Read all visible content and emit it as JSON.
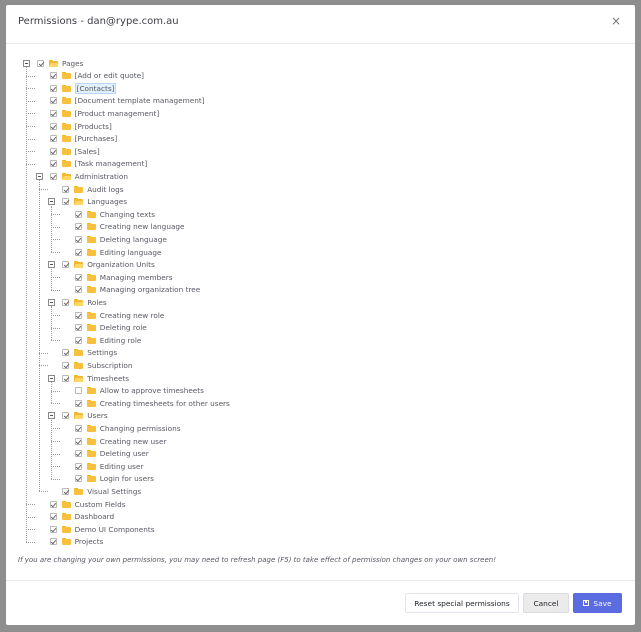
{
  "modal": {
    "title": "Permissions - dan@rype.com.au",
    "close_glyph": "×",
    "note": "If you are changing your own permissions, you may need to refresh page (F5) to take effect of permission changes on your own screen!"
  },
  "footer": {
    "reset_label": "Reset special permissions",
    "cancel_label": "Cancel",
    "save_label": "Save"
  },
  "tree": [
    {
      "id": "pages",
      "label": "Pages",
      "level": 0,
      "checked": true,
      "expanded": true,
      "icon": "folder-open-icon"
    },
    {
      "id": "add-edit-quote",
      "label": "[Add or edit quote]",
      "level": 1,
      "checked": true
    },
    {
      "id": "contacts",
      "label": "[Contacts]",
      "level": 1,
      "checked": true,
      "selected": true
    },
    {
      "id": "document-template-management",
      "label": "[Document template management]",
      "level": 1,
      "checked": true
    },
    {
      "id": "product-management",
      "label": "[Product management]",
      "level": 1,
      "checked": true
    },
    {
      "id": "products",
      "label": "[Products]",
      "level": 1,
      "checked": true
    },
    {
      "id": "purchases",
      "label": "[Purchases]",
      "level": 1,
      "checked": true
    },
    {
      "id": "sales",
      "label": "[Sales]",
      "level": 1,
      "checked": true
    },
    {
      "id": "task-management",
      "label": "[Task management]",
      "level": 1,
      "checked": true
    },
    {
      "id": "administration",
      "label": "Administration",
      "level": 1,
      "checked": true,
      "expanded": true,
      "icon": "folder-open-icon"
    },
    {
      "id": "audit-logs",
      "label": "Audit logs",
      "level": 2,
      "checked": true
    },
    {
      "id": "languages",
      "label": "Languages",
      "level": 2,
      "checked": true,
      "expanded": true,
      "icon": "folder-open-icon"
    },
    {
      "id": "changing-texts",
      "label": "Changing texts",
      "level": 3,
      "checked": true
    },
    {
      "id": "creating-new-language",
      "label": "Creating new language",
      "level": 3,
      "checked": true
    },
    {
      "id": "deleting-language",
      "label": "Deleting language",
      "level": 3,
      "checked": true
    },
    {
      "id": "editing-language",
      "label": "Editing language",
      "level": 3,
      "checked": true
    },
    {
      "id": "organization-units",
      "label": "Organization Units",
      "level": 2,
      "checked": true,
      "expanded": true,
      "icon": "folder-open-icon"
    },
    {
      "id": "managing-members",
      "label": "Managing members",
      "level": 3,
      "checked": true
    },
    {
      "id": "managing-organization-tree",
      "label": "Managing organization tree",
      "level": 3,
      "checked": true
    },
    {
      "id": "roles",
      "label": "Roles",
      "level": 2,
      "checked": true,
      "expanded": true,
      "icon": "folder-open-icon"
    },
    {
      "id": "creating-new-role",
      "label": "Creating new role",
      "level": 3,
      "checked": true
    },
    {
      "id": "deleting-role",
      "label": "Deleting role",
      "level": 3,
      "checked": true
    },
    {
      "id": "editing-role",
      "label": "Editing role",
      "level": 3,
      "checked": true
    },
    {
      "id": "settings",
      "label": "Settings",
      "level": 2,
      "checked": true
    },
    {
      "id": "subscription",
      "label": "Subscription",
      "level": 2,
      "checked": true
    },
    {
      "id": "timesheets",
      "label": "Timesheets",
      "level": 2,
      "checked": true,
      "expanded": true,
      "icon": "folder-open-icon"
    },
    {
      "id": "allow-approve-timesheets",
      "label": "Allow to approve timesheets",
      "level": 3,
      "checked": false
    },
    {
      "id": "creating-timesheets-other-users",
      "label": "Creating timesheets for other users",
      "level": 3,
      "checked": true
    },
    {
      "id": "users",
      "label": "Users",
      "level": 2,
      "checked": true,
      "expanded": true,
      "icon": "folder-open-icon"
    },
    {
      "id": "changing-permissions",
      "label": "Changing permissions",
      "level": 3,
      "checked": true
    },
    {
      "id": "creating-new-user",
      "label": "Creating new user",
      "level": 3,
      "checked": true
    },
    {
      "id": "deleting-user",
      "label": "Deleting user",
      "level": 3,
      "checked": true
    },
    {
      "id": "editing-user",
      "label": "Editing user",
      "level": 3,
      "checked": true
    },
    {
      "id": "login-for-users",
      "label": "Login for users",
      "level": 3,
      "checked": true
    },
    {
      "id": "visual-settings",
      "label": "Visual Settings",
      "level": 2,
      "checked": true
    },
    {
      "id": "custom-fields",
      "label": "Custom Fields",
      "level": 1,
      "checked": true
    },
    {
      "id": "dashboard",
      "label": "Dashboard",
      "level": 1,
      "checked": true
    },
    {
      "id": "demo-ui-components",
      "label": "Demo UI Components",
      "level": 1,
      "checked": true
    },
    {
      "id": "projects",
      "label": "Projects",
      "level": 1,
      "checked": true
    }
  ],
  "colors": {
    "accent": "#5b6be0",
    "folder": "#f8c03c",
    "selection": "#e3f0fd"
  }
}
